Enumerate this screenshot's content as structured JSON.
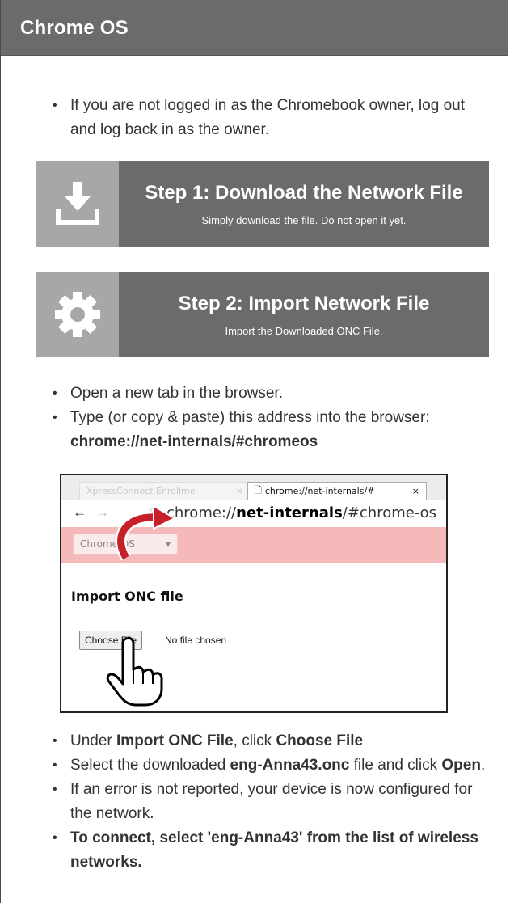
{
  "header": {
    "title": "Chrome OS"
  },
  "intro": {
    "text": "If you are not logged in as the Chromebook owner, log out and log back in as the owner."
  },
  "steps": [
    {
      "title": "Step 1: Download the Network File",
      "subtitle": "Simply download the file. Do not open it yet.",
      "icon": "download-icon"
    },
    {
      "title": "Step 2: Import Network File",
      "subtitle": "Import the Downloaded ONC File.",
      "icon": "gear-icon"
    }
  ],
  "instructions": {
    "open_tab": "Open a new tab in the browser.",
    "type_address": "Type (or copy & paste) this address into the browser:",
    "address": "chrome://net-internals/#chromeos"
  },
  "screenshot": {
    "tab_inactive": "XpressConnect Enrollme",
    "tab_active": "chrome://net-internals/#",
    "tab_close": "×",
    "back": "←",
    "forward": "→",
    "url_prefix": "chrome://",
    "url_strong": "net-internals",
    "url_suffix": "/#chrome-os",
    "dropdown_value": "Chrome OS",
    "dropdown_caret": "▾",
    "import_title": "Import ONC file",
    "choose_file": "Choose File",
    "no_file": "No file chosen"
  },
  "final": {
    "s1_a": "Under ",
    "s1_b": "Import ONC File",
    "s1_c": ", click ",
    "s1_d": "Choose File",
    "s2_a": "Select the downloaded ",
    "s2_b": "eng-Anna43.onc",
    "s2_c": " file and click ",
    "s2_d": "Open",
    "s2_e": ".",
    "s3": "If an error is not reported, your device is now configured for the network.",
    "s4": "To connect, select 'eng-Anna43' from the list of wireless networks."
  },
  "colors": {
    "header_bg": "#6b6b6b",
    "icon_bg": "#a7a7a7",
    "pink_bar": "#f6b9b9",
    "arrow_red": "#c8202a"
  }
}
